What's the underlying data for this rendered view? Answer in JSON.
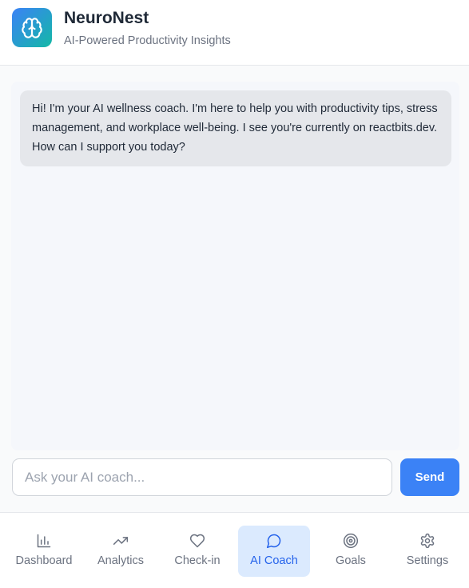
{
  "header": {
    "title": "NeuroNest",
    "subtitle": "AI-Powered Productivity Insights",
    "logo_icon": "brain-icon"
  },
  "chat": {
    "messages": [
      {
        "sender": "assistant",
        "text": "Hi! I'm your AI wellness coach. I'm here to help you with productivity tips, stress management, and workplace well-being. I see you're currently on reactbits.dev. How can I support you today?"
      }
    ],
    "input": {
      "value": "",
      "placeholder": "Ask your AI coach..."
    },
    "send_label": "Send"
  },
  "nav": {
    "items": [
      {
        "label": "Dashboard",
        "icon": "bar-chart-icon",
        "active": false
      },
      {
        "label": "Analytics",
        "icon": "trending-up-icon",
        "active": false
      },
      {
        "label": "Check-in",
        "icon": "heart-icon",
        "active": false
      },
      {
        "label": "AI Coach",
        "icon": "message-circle-icon",
        "active": true
      },
      {
        "label": "Goals",
        "icon": "target-icon",
        "active": false
      },
      {
        "label": "Settings",
        "icon": "gear-icon",
        "active": false
      }
    ]
  },
  "colors": {
    "accent": "#3b82f6",
    "logo_gradient_start": "#3b82f6",
    "logo_gradient_end": "#14b8a6",
    "active_tab_bg": "#dbeafe",
    "active_tab_text": "#2563eb",
    "bubble_bg": "#e5e7eb"
  }
}
